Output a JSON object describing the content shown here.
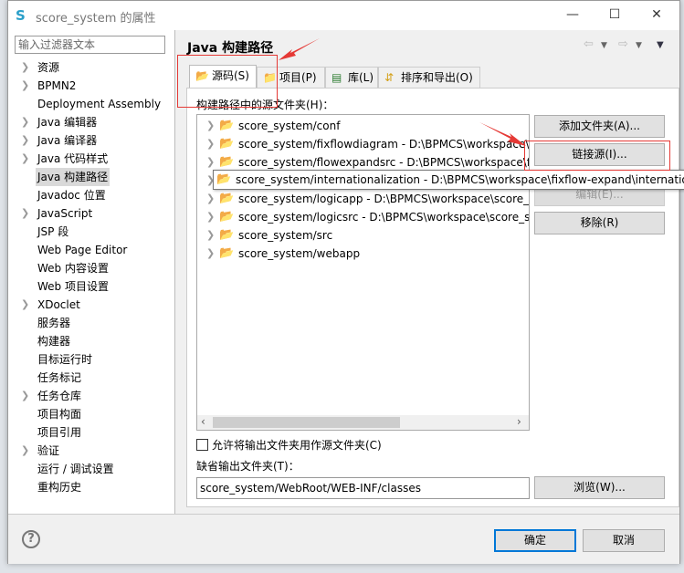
{
  "window": {
    "title": "score_system 的属性",
    "minimize_icon": "minimize-icon",
    "maximize_icon": "maximize-icon",
    "close_icon": "close-icon"
  },
  "sidebar": {
    "filter_placeholder": "输入过滤器文本",
    "items": [
      {
        "label": "资源",
        "expandable": true
      },
      {
        "label": "BPMN2",
        "expandable": true
      },
      {
        "label": "Deployment Assembly",
        "expandable": false
      },
      {
        "label": "Java 编辑器",
        "expandable": true
      },
      {
        "label": "Java 编译器",
        "expandable": true
      },
      {
        "label": "Java 代码样式",
        "expandable": true
      },
      {
        "label": "Java 构建路径",
        "expandable": false,
        "selected": true
      },
      {
        "label": "Javadoc 位置",
        "expandable": false
      },
      {
        "label": "JavaScript",
        "expandable": true
      },
      {
        "label": "JSP 段",
        "expandable": false
      },
      {
        "label": "Web Page Editor",
        "expandable": false
      },
      {
        "label": "Web 内容设置",
        "expandable": false
      },
      {
        "label": "Web 项目设置",
        "expandable": false
      },
      {
        "label": "XDoclet",
        "expandable": true
      },
      {
        "label": "服务器",
        "expandable": false
      },
      {
        "label": "构建器",
        "expandable": false
      },
      {
        "label": "目标运行时",
        "expandable": false
      },
      {
        "label": "任务标记",
        "expandable": false
      },
      {
        "label": "任务仓库",
        "expandable": true
      },
      {
        "label": "项目构面",
        "expandable": false
      },
      {
        "label": "项目引用",
        "expandable": false
      },
      {
        "label": "验证",
        "expandable": true
      },
      {
        "label": "运行 / 调试设置",
        "expandable": false
      },
      {
        "label": "重构历史",
        "expandable": false
      }
    ]
  },
  "main": {
    "heading": "Java 构建路径",
    "tabs": [
      {
        "label": "源码(S)",
        "active": true
      },
      {
        "label": "项目(P)"
      },
      {
        "label": "库(L)"
      },
      {
        "label": "排序和导出(O)"
      }
    ],
    "source_label": "构建路径中的源文件夹(H)：",
    "folders": [
      "score_system/conf",
      "score_system/fixflowdiagram - D:\\BPMCS\\workspace\\fixflow-expand\\fixflowdiagram",
      "score_system/flowexpandsrc - D:\\BPMCS\\workspace\\fixflow-expand\\flowexpandsrc",
      "score_system/internationalization - D:\\BPMCS\\workspace\\fixflow-expand\\internationalization",
      "score_system/logicapp - D:\\BPMCS\\workspace\\score_system\\logicapp",
      "score_system/logicsrc - D:\\BPMCS\\workspace\\score_system\\logicsrc",
      "score_system/src",
      "score_system/webapp"
    ],
    "buttons": {
      "add_folder": "添加文件夹(A)...",
      "link_source": "链接源(I)...",
      "edit": "编辑(E)...",
      "remove": "移除(R)"
    },
    "allow_output_label": "允许将输出文件夹用作源文件夹(C)",
    "allow_output_checked": false,
    "default_output_label": "缺省输出文件夹(T)：",
    "default_output_value": "score_system/WebRoot/WEB-INF/classes",
    "browse": "浏览(W)..."
  },
  "footer": {
    "ok": "确定",
    "cancel": "取消",
    "help": "?"
  },
  "colors": {
    "annotation": "#e53935",
    "default_button": "#0078d7",
    "folder": "#c8962d"
  }
}
